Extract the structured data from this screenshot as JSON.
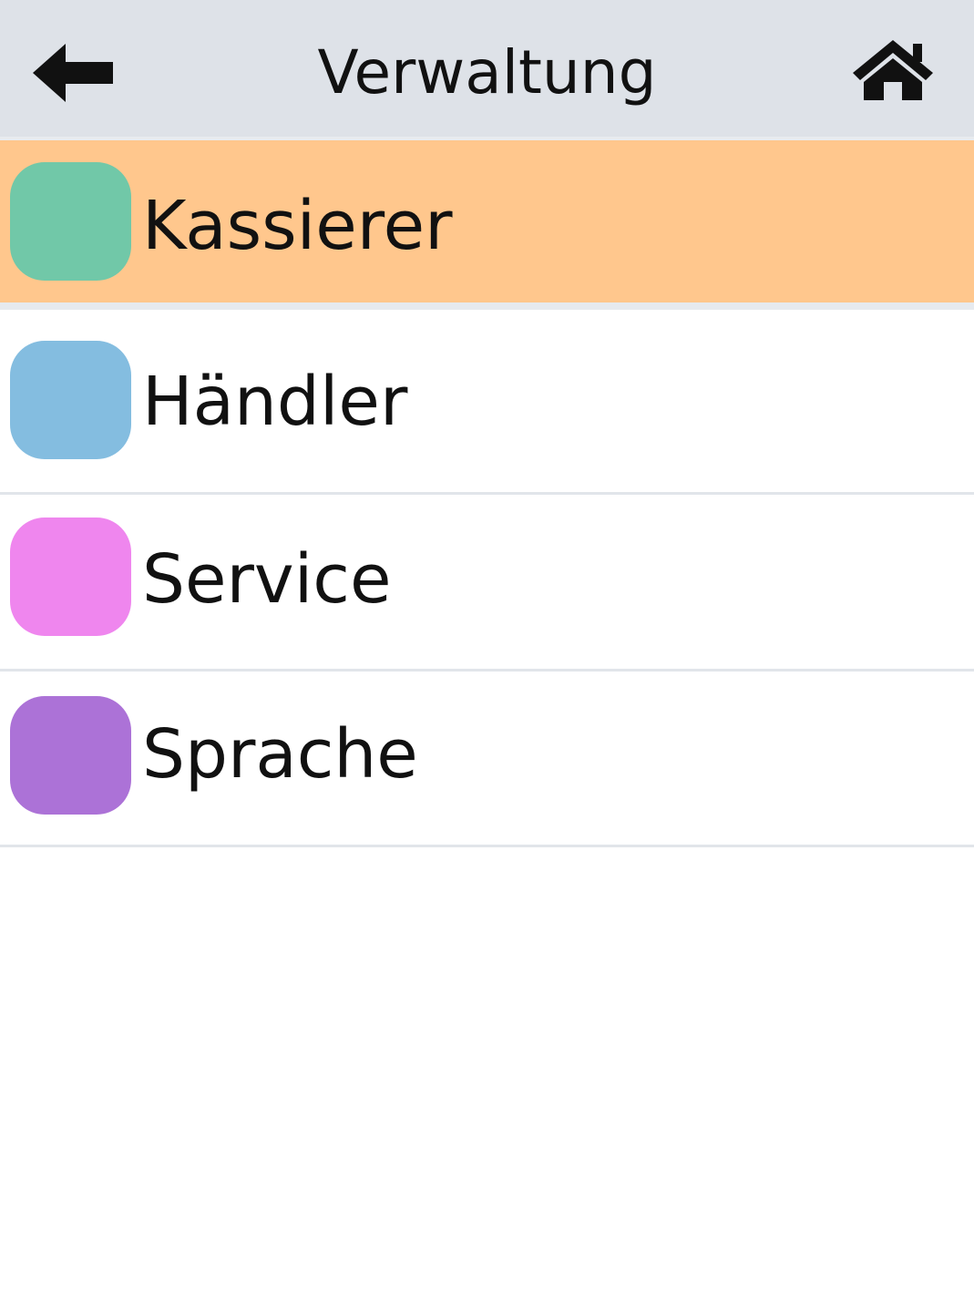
{
  "header": {
    "title": "Verwaltung",
    "back_icon": "back-arrow-icon",
    "home_icon": "home-icon",
    "background": "#dee2e8"
  },
  "menu": {
    "items": [
      {
        "label": "Kassierer",
        "color": "#71c8a8",
        "selected": true,
        "highlight": "#ffc78d"
      },
      {
        "label": "Händler",
        "color": "#84bde0",
        "selected": false
      },
      {
        "label": "Service",
        "color": "#ef86ee",
        "selected": false
      },
      {
        "label": "Sprache",
        "color": "#ac72d7",
        "selected": false
      }
    ]
  }
}
